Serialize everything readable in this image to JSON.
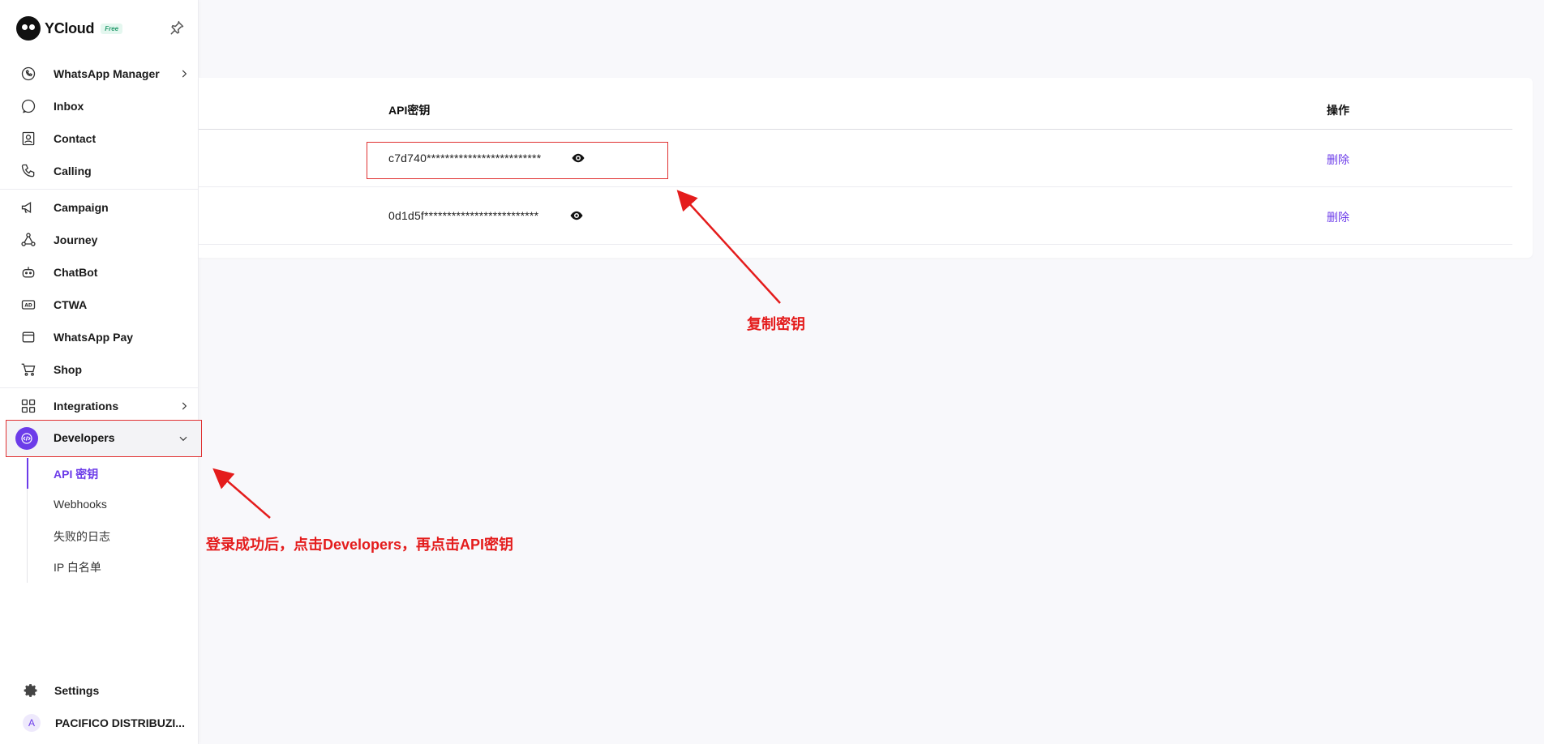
{
  "sidebar": {
    "brand": {
      "name": "YCloud",
      "badge": "Free"
    },
    "groups": {
      "main": [
        {
          "label": "WhatsApp Manager",
          "icon": "whatsapp-icon",
          "has_chevron": true
        },
        {
          "label": "Inbox",
          "icon": "chat-bubble-icon"
        },
        {
          "label": "Contact",
          "icon": "contact-card-icon"
        },
        {
          "label": "Calling",
          "icon": "phone-icon"
        }
      ],
      "marketing": [
        {
          "label": "Campaign",
          "icon": "megaphone-icon"
        },
        {
          "label": "Journey",
          "icon": "flow-icon"
        },
        {
          "label": "ChatBot",
          "icon": "robot-icon"
        },
        {
          "label": "CTWA",
          "icon": "ad-icon"
        },
        {
          "label": "WhatsApp Pay",
          "icon": "wallet-icon"
        },
        {
          "label": "Shop",
          "icon": "cart-icon"
        }
      ],
      "dev": [
        {
          "label": "Integrations",
          "icon": "grid-icon",
          "has_chevron": true
        },
        {
          "label": "Developers",
          "icon": "code-icon",
          "expanded": true
        }
      ]
    },
    "developers_sub": [
      {
        "label": "API 密钥",
        "active": true
      },
      {
        "label": "Webhooks"
      },
      {
        "label": "失败的日志"
      },
      {
        "label": "IP 白名单"
      }
    ],
    "bottom": {
      "settings": "Settings",
      "account_initial": "A",
      "account_name": "PACIFICO DISTRIBUZI..."
    }
  },
  "table": {
    "columns": {
      "api_key": "API密钥",
      "actions": "操作"
    },
    "rows": [
      {
        "api_key": "c7d740*************************",
        "action": "删除"
      },
      {
        "api_key": "0d1d5f*************************",
        "action": "删除"
      }
    ]
  },
  "annotations": {
    "copy_key": "复制密钥",
    "login_hint": "登录成功后，点击Developers，再点击API密钥"
  },
  "colors": {
    "accent": "#6c3ce9",
    "annotation": "#e41c1c"
  }
}
